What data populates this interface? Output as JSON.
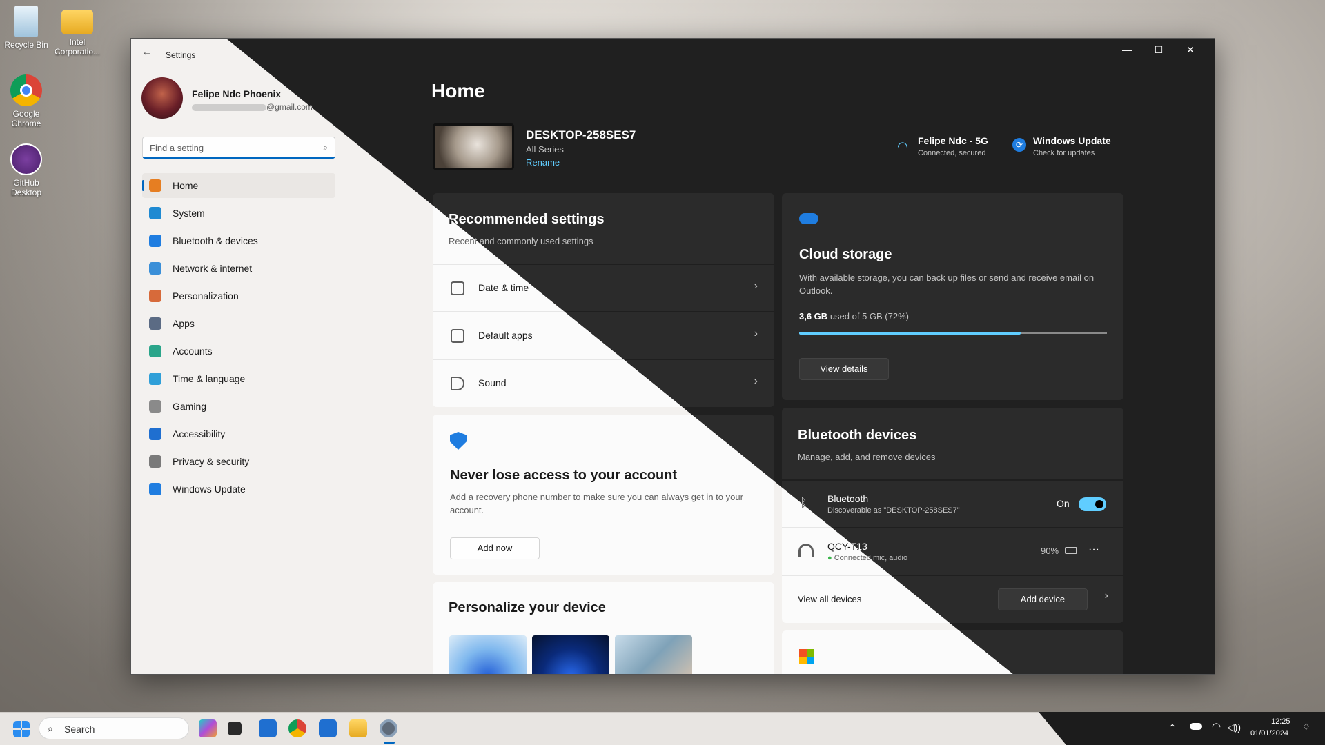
{
  "desktop": {
    "icons": [
      {
        "label": "Recycle Bin"
      },
      {
        "label": "Intel Corporatio..."
      },
      {
        "label": "Google Chrome"
      },
      {
        "label": "GitHub Desktop"
      }
    ]
  },
  "window": {
    "app_title": "Settings",
    "back_icon": "back-arrow-icon",
    "controls": {
      "minimize": "—",
      "maximize": "☐",
      "close": "✕"
    }
  },
  "profile": {
    "name": "Felipe Ndc Phoenix",
    "email_suffix": "@gmail.com"
  },
  "search": {
    "placeholder": "Find a setting",
    "value": ""
  },
  "nav": {
    "items": [
      {
        "label": "Home",
        "icon": "home-icon",
        "color": "#e67e22"
      },
      {
        "label": "System",
        "icon": "system-icon",
        "color": "#1f8ad2"
      },
      {
        "label": "Bluetooth & devices",
        "icon": "bluetooth-icon",
        "color": "#1f7de0"
      },
      {
        "label": "Network & internet",
        "icon": "wifi-icon",
        "color": "#3a8fd8"
      },
      {
        "label": "Personalization",
        "icon": "brush-icon",
        "color": "#d76a3a"
      },
      {
        "label": "Apps",
        "icon": "apps-icon",
        "color": "#5b6b84"
      },
      {
        "label": "Accounts",
        "icon": "accounts-icon",
        "color": "#2aa58a"
      },
      {
        "label": "Time & language",
        "icon": "globe-icon",
        "color": "#2f9fd8"
      },
      {
        "label": "Gaming",
        "icon": "gaming-icon",
        "color": "#8a8a8a"
      },
      {
        "label": "Accessibility",
        "icon": "accessibility-icon",
        "color": "#1f6fd0"
      },
      {
        "label": "Privacy & security",
        "icon": "shield-icon",
        "color": "#7a7a7a"
      },
      {
        "label": "Windows Update",
        "icon": "update-icon",
        "color": "#1f7de0"
      }
    ],
    "active_index": 0
  },
  "main": {
    "page_title": "Home",
    "device": {
      "name": "DESKTOP-258SES7",
      "series": "All Series",
      "rename_label": "Rename"
    },
    "status": {
      "network": {
        "title": "Felipe Ndc - 5G",
        "subtitle": "Connected, secured"
      },
      "update": {
        "title": "Windows Update",
        "subtitle": "Check for updates"
      }
    },
    "recommended": {
      "title": "Recommended settings",
      "subtitle": "Recent and commonly used settings",
      "items": [
        {
          "label": "Date & time",
          "icon": "clock-icon"
        },
        {
          "label": "Default apps",
          "icon": "default-apps-icon"
        },
        {
          "label": "Sound",
          "icon": "speaker-icon"
        }
      ]
    },
    "account": {
      "title": "Never lose access to your account",
      "body": "Add a recovery phone number to make sure you can always get in to your account.",
      "button": "Add now"
    },
    "personalize": {
      "title": "Personalize your device"
    },
    "cloud": {
      "title": "Cloud storage",
      "body": "With available storage, you can back up files or send and receive email on Outlook.",
      "used": "3,6 GB",
      "of_text": "used of 5 GB (72%)",
      "usage_fraction": 0.72,
      "button": "View details"
    },
    "bluetooth": {
      "title": "Bluetooth devices",
      "subtitle": "Manage, add, and remove devices",
      "bt_label": "Bluetooth",
      "bt_sub": "Discoverable as \"DESKTOP-258SES7\"",
      "bt_state": "On",
      "device_name": "QCY-T13",
      "device_status": "Connected mic, audio",
      "battery": "90%",
      "more": "···",
      "view_all": "View all devices",
      "add_button": "Add device"
    }
  },
  "taskbar": {
    "search_placeholder": "Search",
    "time": "12:25",
    "date": "01/01/2024"
  }
}
